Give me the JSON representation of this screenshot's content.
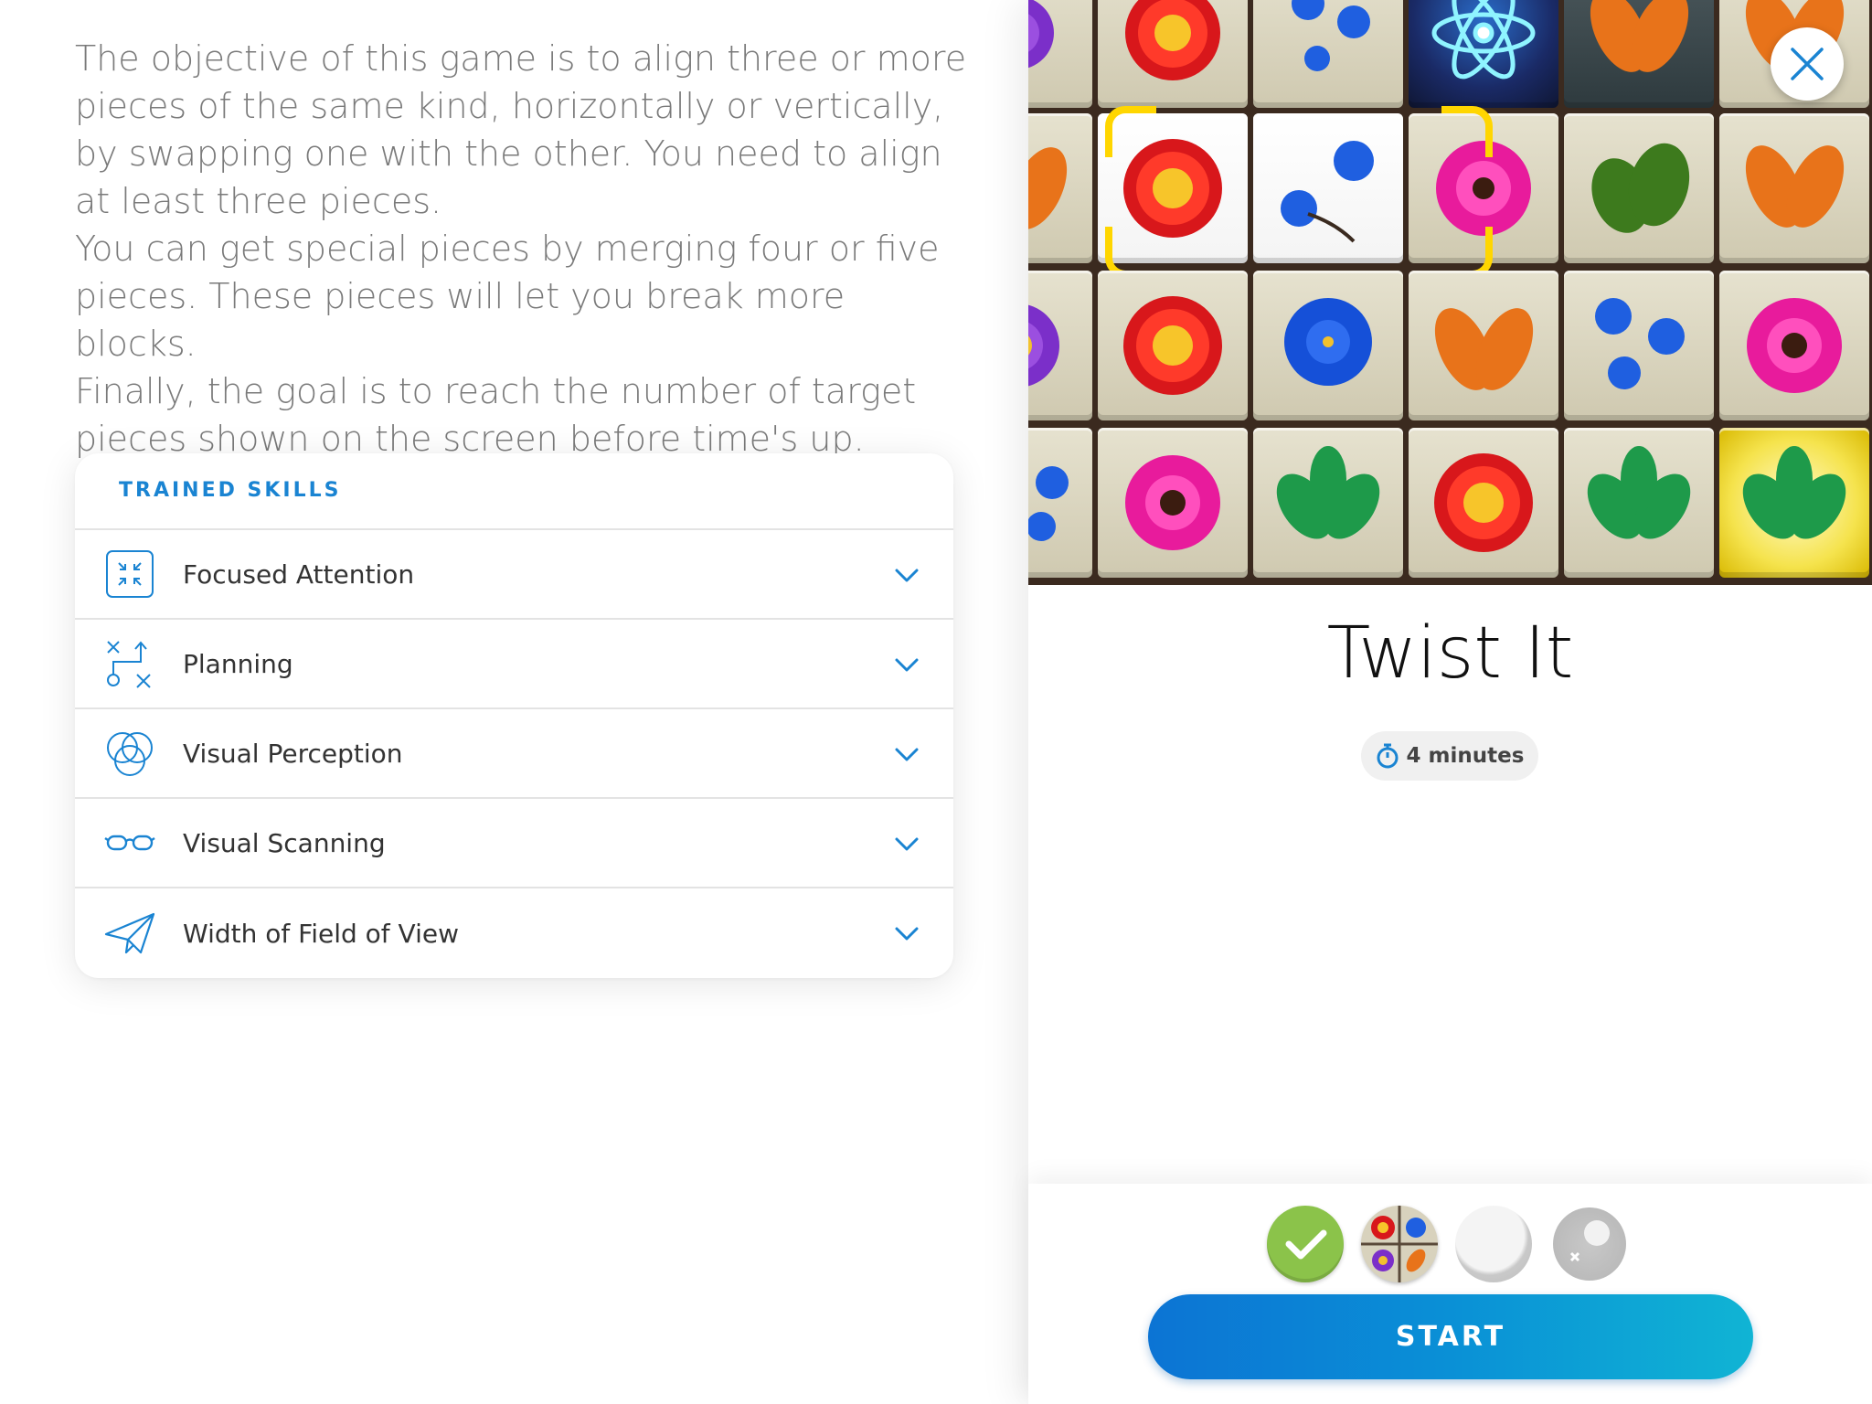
{
  "description": {
    "paragraph_1": "The objective of this game is to align three or more pieces of the same kind, horizontally or vertically, by swapping one with the other. You need to align at least three pieces.",
    "paragraph_2": "You can get special pieces by merging four or five pieces. These pieces will let you break more blocks.",
    "paragraph_3": "Finally, the goal is to reach the number of target pieces shown on the screen before time's up."
  },
  "skills": {
    "title": "TRAINED SKILLS",
    "items": [
      {
        "label": "Focused Attention",
        "icon": "focus-arrows-icon"
      },
      {
        "label": "Planning",
        "icon": "planning-icon"
      },
      {
        "label": "Visual Perception",
        "icon": "circles-icon"
      },
      {
        "label": "Visual Scanning",
        "icon": "glasses-icon"
      },
      {
        "label": "Width of Field of View",
        "icon": "paper-plane-icon"
      }
    ]
  },
  "game": {
    "title": "Twist It",
    "duration": "4 minutes",
    "start_label": "START"
  },
  "progress": [
    {
      "state": "completed",
      "icon": "check-icon"
    },
    {
      "state": "current",
      "icon": "board-thumbnail-icon"
    },
    {
      "state": "locked",
      "icon": "empty-circle-icon"
    },
    {
      "state": "locked",
      "icon": "locked-level-icon"
    }
  ],
  "colors": {
    "accent": "#1a84d2",
    "start_gradient_from": "#0c74d4",
    "start_gradient_to": "#10b4d4",
    "check_green": "#8bc34a",
    "selection_yellow": "#ffd600"
  }
}
